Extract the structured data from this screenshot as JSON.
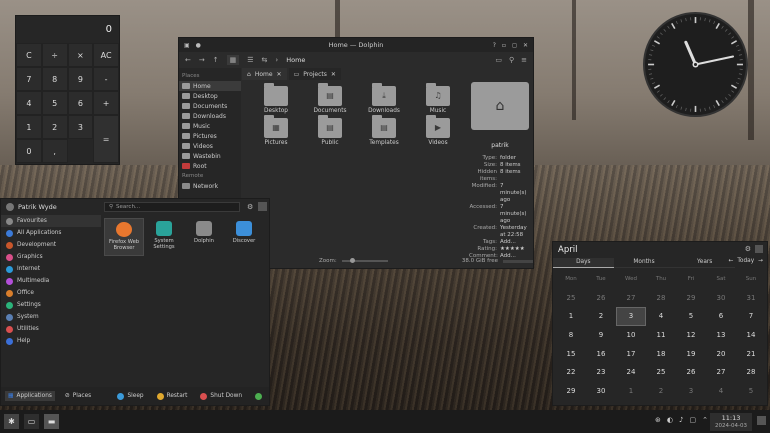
{
  "calculator": {
    "display": "0",
    "keys": [
      "C",
      "÷",
      "×",
      "AC",
      "7",
      "8",
      "9",
      "-",
      "4",
      "5",
      "6",
      "+",
      "1",
      "2",
      "3",
      "=",
      "0",
      ","
    ]
  },
  "dolphin": {
    "title": "Home — Dolphin",
    "breadcrumb": "Home",
    "places_header": "Places",
    "remote_header": "Remote",
    "places": [
      {
        "label": "Home",
        "color": "#9a9a9a"
      },
      {
        "label": "Desktop",
        "color": "#9a9a9a"
      },
      {
        "label": "Documents",
        "color": "#9a9a9a"
      },
      {
        "label": "Downloads",
        "color": "#9a9a9a"
      },
      {
        "label": "Music",
        "color": "#9a9a9a"
      },
      {
        "label": "Pictures",
        "color": "#9a9a9a"
      },
      {
        "label": "Videos",
        "color": "#9a9a9a"
      },
      {
        "label": "Wastebin",
        "color": "#9a9a9a"
      },
      {
        "label": "Root",
        "color": "#c23b3b"
      }
    ],
    "remote": [
      {
        "label": "Network"
      }
    ],
    "tabs": [
      {
        "label": "Home"
      },
      {
        "label": "Projects"
      }
    ],
    "files": [
      {
        "label": "Desktop",
        "icon": "desktop-icon",
        "glyph": ""
      },
      {
        "label": "Documents",
        "icon": "documents-icon",
        "glyph": "▤"
      },
      {
        "label": "Downloads",
        "icon": "downloads-icon",
        "glyph": "⤓"
      },
      {
        "label": "Music",
        "icon": "music-icon",
        "glyph": "♫"
      },
      {
        "label": "Pictures",
        "icon": "pictures-icon",
        "glyph": "▦"
      },
      {
        "label": "Public",
        "icon": "public-icon",
        "glyph": "▤"
      },
      {
        "label": "Templates",
        "icon": "templates-icon",
        "glyph": "▤"
      },
      {
        "label": "Videos",
        "icon": "videos-icon",
        "glyph": "▶"
      }
    ],
    "info": {
      "name": "patrik",
      "rows": [
        {
          "k": "Type:",
          "v": "folder"
        },
        {
          "k": "Size:",
          "v": "8 items"
        },
        {
          "k": "Hidden items:",
          "v": "8 items"
        },
        {
          "k": "Modified:",
          "v": "7 minute(s) ago"
        },
        {
          "k": "Accessed:",
          "v": "7 minute(s) ago"
        },
        {
          "k": "Created:",
          "v": "Yesterday at 22:58"
        },
        {
          "k": "Tags:",
          "v": "Add..."
        },
        {
          "k": "Rating:",
          "v": "★★★★★"
        },
        {
          "k": "Comment:",
          "v": "Add..."
        }
      ]
    },
    "zoom_label": "Zoom:",
    "free_space": "38.0 GiB free"
  },
  "clock": {
    "hour": 11,
    "minute": 13
  },
  "launcher": {
    "user": "Patrik Wyde",
    "search_placeholder": "Search...",
    "categories": [
      {
        "label": "Favourites",
        "color": "#888"
      },
      {
        "label": "All Applications",
        "color": "#3b7ad8"
      },
      {
        "label": "Development",
        "color": "#c8562b"
      },
      {
        "label": "Graphics",
        "color": "#d94f8a"
      },
      {
        "label": "Internet",
        "color": "#2b9ad9"
      },
      {
        "label": "Multimedia",
        "color": "#b34fd9"
      },
      {
        "label": "Office",
        "color": "#d97e2b"
      },
      {
        "label": "Settings",
        "color": "#2bb37a"
      },
      {
        "label": "System",
        "color": "#5a7fb3"
      },
      {
        "label": "Utilities",
        "color": "#d94f4f"
      },
      {
        "label": "Help",
        "color": "#3b6fd8"
      }
    ],
    "apps": [
      {
        "label": "Firefox Web Browser",
        "color": "#e8772e",
        "icon": "firefox-icon"
      },
      {
        "label": "System Settings",
        "color": "#2aa39a",
        "icon": "system-settings-icon"
      },
      {
        "label": "Dolphin",
        "color": "#8a8a8a",
        "icon": "dolphin-icon"
      },
      {
        "label": "Discover",
        "color": "#3c8fd9",
        "icon": "discover-icon"
      }
    ],
    "footer": {
      "applications": "Applications",
      "places": "Places",
      "sleep": "Sleep",
      "restart": "Restart",
      "shutdown": "Shut Down"
    }
  },
  "calendar": {
    "month": "April",
    "tabs": [
      "Days",
      "Months",
      "Years"
    ],
    "today_label": "Today",
    "weekdays": [
      "Mon",
      "Tue",
      "Wed",
      "Thu",
      "Fri",
      "Sat",
      "Sun"
    ],
    "weeks": [
      [
        "25",
        "26",
        "27",
        "28",
        "29",
        "30",
        "31"
      ],
      [
        "1",
        "2",
        "3",
        "4",
        "5",
        "6",
        "7"
      ],
      [
        "8",
        "9",
        "10",
        "11",
        "12",
        "13",
        "14"
      ],
      [
        "15",
        "16",
        "17",
        "18",
        "19",
        "20",
        "21"
      ],
      [
        "22",
        "23",
        "24",
        "25",
        "26",
        "27",
        "28"
      ],
      [
        "29",
        "30",
        "1",
        "2",
        "3",
        "4",
        "5"
      ]
    ],
    "today": "3"
  },
  "taskbar": {
    "time": "11:13",
    "date": "2024-04-03"
  }
}
